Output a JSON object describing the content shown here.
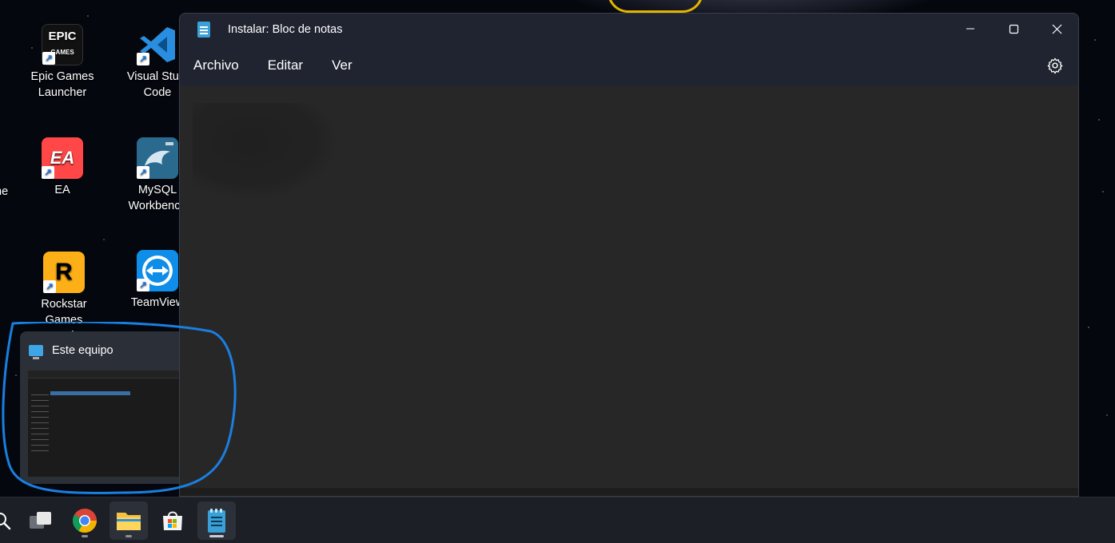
{
  "desktop": {
    "icons": [
      {
        "label_line1": "Epic Games",
        "label_line2": "Launcher",
        "glyph": "EPIC",
        "sub_glyph": "GAMES",
        "icon": "epic-games-icon"
      },
      {
        "label_line1": "Visual Studi",
        "label_line2": "Code",
        "icon": "vscode-icon"
      },
      {
        "label_line1": "ne",
        "label_line2": "",
        "icon": "partial-icon"
      },
      {
        "label_line1": "EA",
        "label_line2": "",
        "glyph": "EA",
        "icon": "ea-icon"
      },
      {
        "label_line1": "MySQL",
        "label_line2": "Workbench",
        "icon": "mysql-workbench-icon"
      },
      {
        "label_line1": "Rockstar Games",
        "label_line2": "Launcher",
        "glyph": "R",
        "icon": "rockstar-icon"
      },
      {
        "label_line1": "TeamView",
        "label_line2": "",
        "icon": "teamviewer-icon"
      }
    ],
    "shortcut_arrow": "↗"
  },
  "window": {
    "title": "Instalar: Bloc de notas",
    "controls": {
      "minimize": "—",
      "maximize": "☐",
      "close": "✕"
    },
    "menu": [
      "Archivo",
      "Editar",
      "Ver"
    ],
    "settings_icon": "gear-icon"
  },
  "preview": {
    "title": "Este equipo",
    "icon": "monitor-icon"
  },
  "annotation": {
    "color": "#1a7fe0"
  },
  "taskbar": {
    "items": [
      {
        "name": "search",
        "icon": "search-icon"
      },
      {
        "name": "task-view",
        "icon": "task-view-icon"
      },
      {
        "name": "chrome",
        "icon": "chrome-icon"
      },
      {
        "name": "file-explorer",
        "icon": "folder-icon"
      },
      {
        "name": "microsoft-store",
        "icon": "store-icon"
      },
      {
        "name": "notepad",
        "icon": "notepad-icon"
      }
    ]
  },
  "colors": {
    "window_bg": "#272727",
    "titlebar_bg": "#1f2430",
    "taskbar_bg": "#1c1f26",
    "accent": "#3aa0d8"
  }
}
